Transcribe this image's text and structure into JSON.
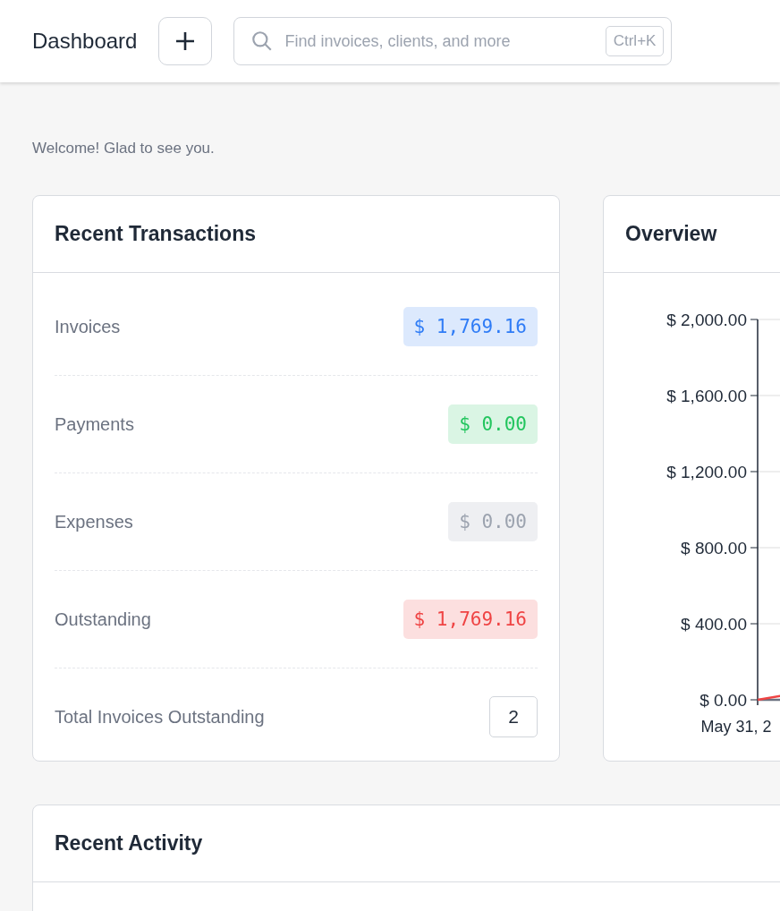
{
  "header": {
    "title": "Dashboard",
    "search": {
      "placeholder": "Find invoices, clients, and more",
      "shortcut": "Ctrl+K"
    }
  },
  "welcome": "Welcome! Glad to see you.",
  "recent_transactions": {
    "title": "Recent Transactions",
    "rows": [
      {
        "label": "Invoices",
        "value": "$ 1,769.16",
        "kind": "amount",
        "color": "#2f7cf6"
      },
      {
        "label": "Payments",
        "value": "$ 0.00",
        "kind": "amount",
        "color": "#22c55e"
      },
      {
        "label": "Expenses",
        "value": "$ 0.00",
        "kind": "amount",
        "color": "#9ca3af"
      },
      {
        "label": "Outstanding",
        "value": "$ 1,769.16",
        "kind": "amount",
        "color": "#ef4444"
      },
      {
        "label": "Total Invoices Outstanding",
        "value": "2",
        "kind": "count"
      }
    ]
  },
  "overview": {
    "title": "Overview",
    "y_labels": [
      "$ 2,000.00",
      "$ 1,600.00",
      "$ 1,200.00",
      "$ 800.00",
      "$ 400.00",
      "$ 0.00"
    ],
    "x_labels": [
      "May 31, 2"
    ]
  },
  "recent_activity": {
    "title": "Recent Activity"
  }
}
